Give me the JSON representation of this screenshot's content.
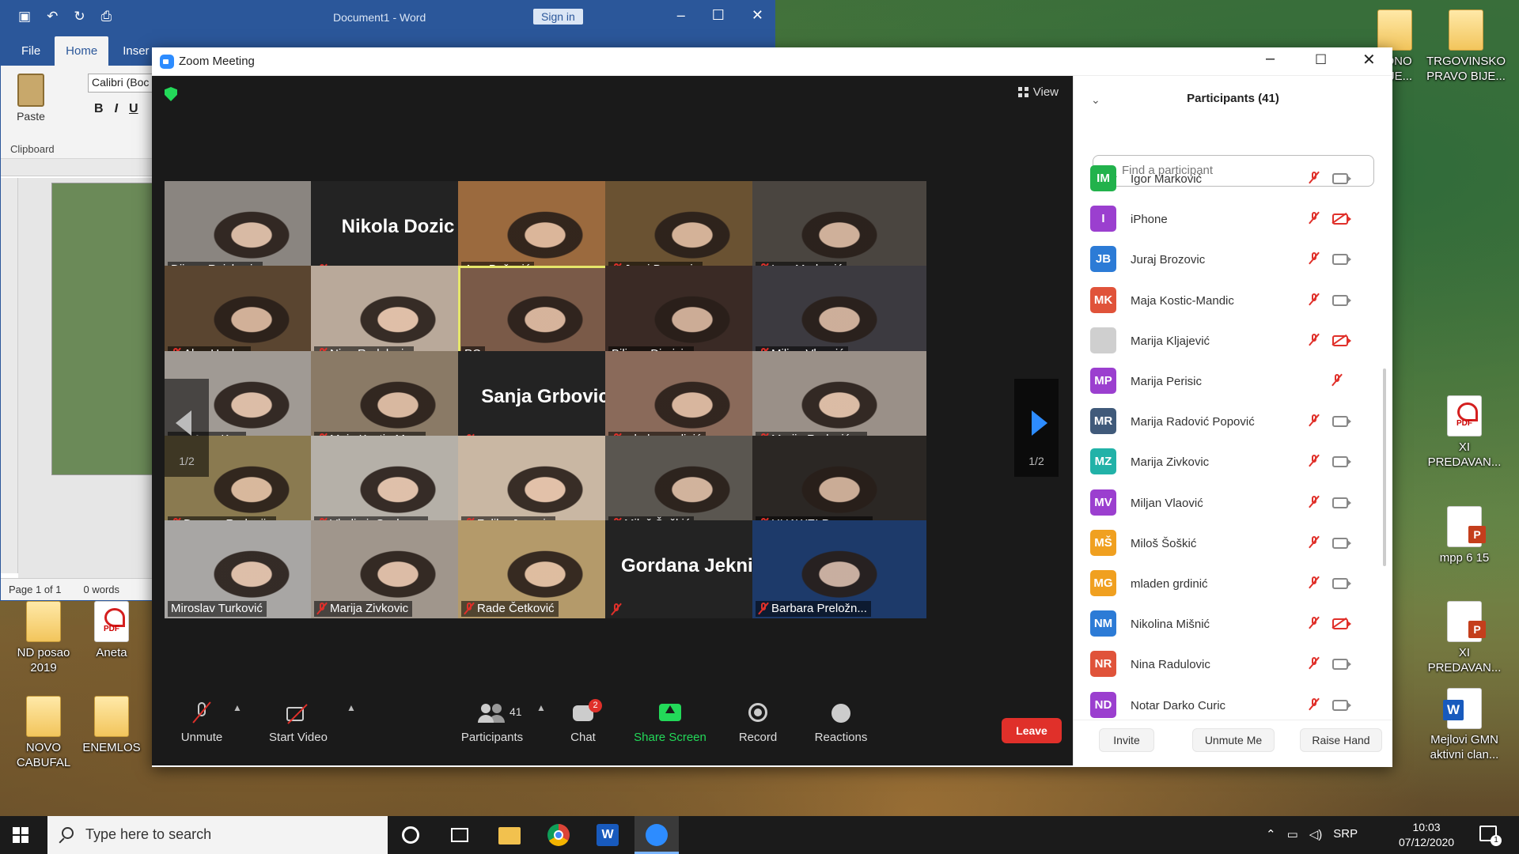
{
  "word": {
    "doc_title": "Document1  -  Word",
    "signin_label": "Sign in",
    "tabs": [
      "File",
      "Home",
      "Inser"
    ],
    "paste_label": "Paste",
    "clipboard_label": "Clipboard",
    "font_value": "Calibri (Boc",
    "status_page": "Page 1 of 1",
    "status_words": "0 words"
  },
  "desktop_icons": {
    "left": [
      {
        "label": "ND posao\n2019",
        "kind": "doc"
      },
      {
        "label": "Aneta",
        "kind": "pdf"
      },
      {
        "label": "NOVO\nCABUFAL",
        "kind": "doc"
      },
      {
        "label": "ENEMLOS",
        "kind": "doc"
      }
    ],
    "top_right": [
      {
        "label": "EDNO\n BIJE...",
        "kind": "doc"
      },
      {
        "label": "TRGOVINSKO\nPRAVO BIJE...",
        "kind": "doc"
      }
    ],
    "right": [
      {
        "label": "XI\nPREDAVAN...",
        "kind": "pdf"
      },
      {
        "label": "mpp 6 15",
        "kind": "ppt"
      },
      {
        "label": "XI\nPREDAVAN...",
        "kind": "ppt"
      },
      {
        "label": "Mejlovi GMN\naktivni clan...",
        "kind": "word"
      }
    ]
  },
  "zoom": {
    "window_title": "Zoom Meeting",
    "view_label": "View",
    "page_indicator": "1/2",
    "tiles": [
      {
        "name": "Dijana Raickovic",
        "muted": false,
        "video": true,
        "bg": "#8a8580"
      },
      {
        "name": "Nikola Dozic",
        "muted": true,
        "video": false
      },
      {
        "name": "Ana Božović",
        "muted": false,
        "video": true,
        "bg": "#9b6a3e"
      },
      {
        "name": "Juraj Brozovic",
        "muted": true,
        "video": true,
        "bg": "#6a5232"
      },
      {
        "name": "Igor Marković",
        "muted": true,
        "video": true,
        "bg": "#4a4540"
      },
      {
        "name": "Alan Uzelac",
        "muted": true,
        "video": true,
        "bg": "#5a4530"
      },
      {
        "name": "Nina Radulovic",
        "muted": true,
        "video": true,
        "bg": "#b9a99a"
      },
      {
        "name": "PC",
        "muted": false,
        "video": true,
        "bg": "#7a5a48",
        "speaker": true
      },
      {
        "name": "Biljana Djuricin",
        "muted": false,
        "video": true,
        "bg": "#3a2a25"
      },
      {
        "name": "Miljan Vlaović",
        "muted": true,
        "video": true,
        "bg": "#3c3a40"
      },
      {
        "name": "ana Aras Kr...",
        "muted": false,
        "video": true,
        "bg": "#a09a94"
      },
      {
        "name": "Maja Kostic-Ma...",
        "muted": true,
        "video": true,
        "bg": "#8a7a66"
      },
      {
        "name": "Sanja Grbovic",
        "muted": true,
        "video": false
      },
      {
        "name": "mladen grdinić",
        "muted": true,
        "video": true,
        "bg": "#8a6a5a"
      },
      {
        "name": "Marija Radović ...",
        "muted": true,
        "video": true,
        "bg": "#9a9088"
      },
      {
        "name": "Dragan Radonjic",
        "muted": true,
        "video": true,
        "bg": "#8a7a50"
      },
      {
        "name": "Vladimir Savkov...",
        "muted": true,
        "video": true,
        "bg": "#b5b0a8"
      },
      {
        "name": "Zeljka Jovovic",
        "muted": true,
        "video": true,
        "bg": "#c9b7a3"
      },
      {
        "name": "Miloš Šoškić",
        "muted": true,
        "video": true,
        "bg": "#5a5650"
      },
      {
        "name": "HUAWEI P smar...",
        "muted": true,
        "video": true,
        "bg": "#2b2724"
      },
      {
        "name": "Miroslav Turković",
        "muted": false,
        "video": true,
        "bg": "#a8a6a4"
      },
      {
        "name": "Marija Zivkovic",
        "muted": true,
        "video": true,
        "bg": "#a0968c"
      },
      {
        "name": "Rade Četković",
        "muted": true,
        "video": true,
        "bg": "#b49a6a"
      },
      {
        "name": "Gordana Jeknić",
        "muted": true,
        "video": false
      },
      {
        "name": "Barbara Preložn...",
        "muted": true,
        "video": true,
        "bg": "#1d3a6a"
      }
    ],
    "toolbar": {
      "unmute": "Unmute",
      "start_video": "Start Video",
      "participants": "Participants",
      "participants_count": "41",
      "chat": "Chat",
      "chat_badge": "2",
      "share_screen": "Share Screen",
      "record": "Record",
      "reactions": "Reactions",
      "leave": "Leave"
    },
    "panel": {
      "title": "Participants (41)",
      "search_placeholder": "Find a participant",
      "participants": [
        {
          "initials": "IM",
          "name": "Igor Marković",
          "color": "#22b24c",
          "cam_off": false
        },
        {
          "initials": "I",
          "name": "iPhone",
          "color": "#9b3fcf",
          "cam_off": true
        },
        {
          "initials": "JB",
          "name": "Juraj Brozovic",
          "color": "#2c7bd6",
          "cam_off": false
        },
        {
          "initials": "MK",
          "name": "Maja Kostic-Mandic",
          "color": "#e0533a",
          "cam_off": false
        },
        {
          "initials": "",
          "name": "Marija Kljajević",
          "color": "#cfcfcf",
          "cam_off": true
        },
        {
          "initials": "MP",
          "name": "Marija Perisic",
          "color": "#9b3fcf",
          "cam_off": null
        },
        {
          "initials": "MR",
          "name": "Marija Radović Popović",
          "color": "#405a7a",
          "cam_off": false
        },
        {
          "initials": "MZ",
          "name": "Marija Zivkovic",
          "color": "#22b2a8",
          "cam_off": false
        },
        {
          "initials": "MV",
          "name": "Miljan Vlaović",
          "color": "#9b3fcf",
          "cam_off": false
        },
        {
          "initials": "MŠ",
          "name": "Miloš Šoškić",
          "color": "#f0a020",
          "cam_off": false
        },
        {
          "initials": "MG",
          "name": "mladen grdinić",
          "color": "#f0a020",
          "cam_off": false
        },
        {
          "initials": "NM",
          "name": "Nikolina Mišnić",
          "color": "#2c7bd6",
          "cam_off": true
        },
        {
          "initials": "NR",
          "name": "Nina Radulovic",
          "color": "#e0533a",
          "cam_off": false
        },
        {
          "initials": "ND",
          "name": "Notar Darko Curic",
          "color": "#9b3fcf",
          "cam_off": false
        }
      ],
      "invite": "Invite",
      "unmute_me": "Unmute Me",
      "raise_hand": "Raise Hand"
    }
  },
  "taskbar": {
    "search_placeholder": "Type here to search",
    "lang": "SRP",
    "time": "10:03",
    "date": "07/12/2020",
    "notification_count": "1"
  }
}
